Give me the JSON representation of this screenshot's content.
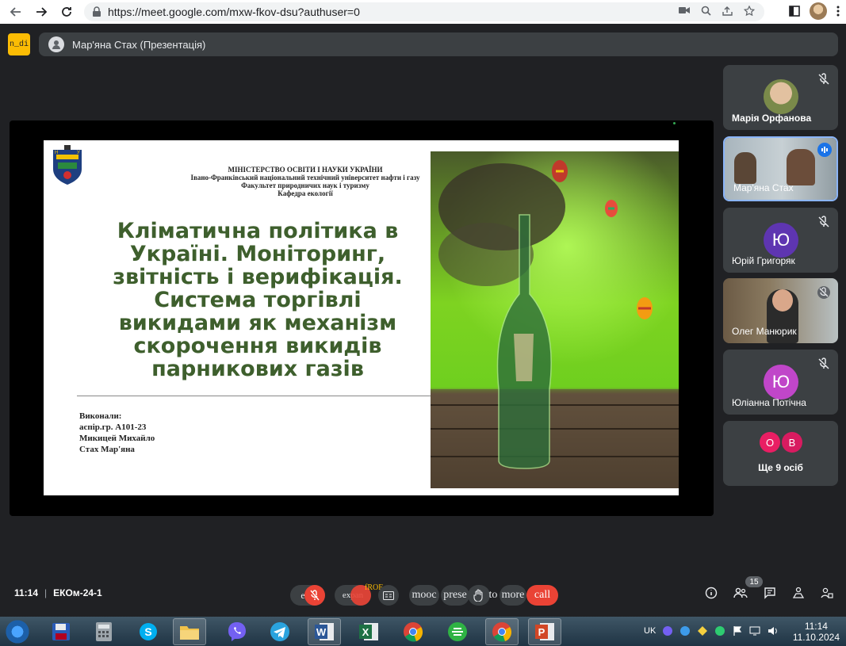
{
  "browser": {
    "url": "https://meet.google.com/mxw-fkov-dsu?authuser=0"
  },
  "meet": {
    "logo_text": "n_di",
    "presenter_label": "Мар'яна Стах (Презентація)",
    "meeting_time": "11:14",
    "meeting_code": "ЕКОм-24-1",
    "participants_count": "15"
  },
  "slide": {
    "header_lines": [
      "МІНІСТЕРСТВО ОСВІТИ І НАУКИ УКРАЇНИ",
      "Івано-Франківський національний технічний університет нафти і газу",
      "Факультет природничих наук і туризму",
      "Кафедра екології"
    ],
    "title": "Кліматична політика в Україні. Моніторинг, звітність і верифікація. Система торгівлі викидами як механізм скорочення викидів парникових газів",
    "authors": [
      "Виконали:",
      "аспір.гр. А101-23",
      "Микицей Михайло",
      "Стах Мар'яна"
    ]
  },
  "participants": [
    {
      "name": "Марія Орфанова",
      "muted": true
    },
    {
      "name": "Мар'яна Стах",
      "speaking": true
    },
    {
      "name": "Юрій Григоряк",
      "initial": "Ю",
      "color": "#5e35b1",
      "muted": true
    },
    {
      "name": "Олег Манюрик",
      "muted": true
    },
    {
      "name": "Юліанна Потічна",
      "initial": "Ю",
      "color": "#c046c9",
      "muted": true
    }
  ],
  "more": {
    "label": "Ще 9 осіб",
    "avatars": [
      {
        "letter": "О",
        "color": "#e91e63"
      },
      {
        "letter": "В",
        "color": "#d81b60"
      }
    ]
  },
  "controls": {
    "labels": [
      "exp",
      "expan",
      "mooc",
      "prese",
      "to",
      "more",
      "call"
    ],
    "captions_overlay": "fROE"
  },
  "taskbar": {
    "lang": "UK",
    "time": "11:14",
    "date": "11.10.2024"
  }
}
